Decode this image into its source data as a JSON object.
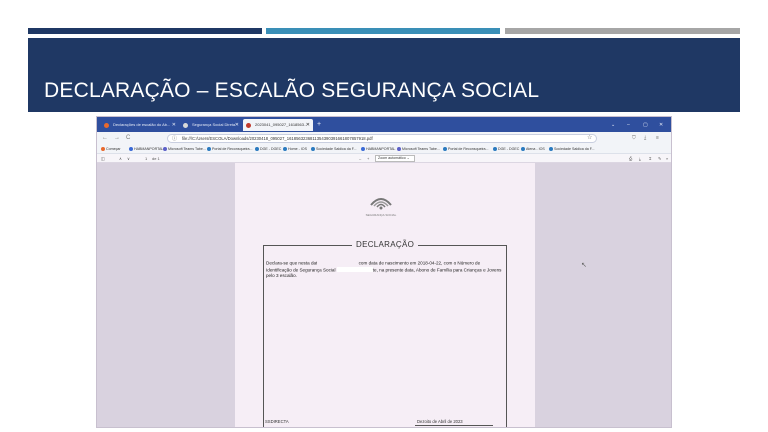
{
  "slide": {
    "title": "DECLARAÇÃO – ESCALÃO SEGURANÇA SOCIAL",
    "colors": {
      "dark_blue": "#1f3864",
      "mid_blue": "#3a8fb7",
      "gray": "#a6a6a6"
    }
  },
  "browser": {
    "tabs": [
      {
        "label": "Declarações de escalão do Ab...",
        "active": false,
        "icon": "firefox-icon"
      },
      {
        "label": "Segurança Social Direta",
        "active": false,
        "icon": "ss-icon"
      },
      {
        "label": "2023041_095027_1618563...",
        "active": true,
        "icon": "pdf-icon"
      }
    ],
    "new_tab": "+",
    "window_controls": [
      "⌄",
      "–",
      "▢",
      "✕"
    ],
    "nav": {
      "back": "←",
      "forward": "→",
      "reload": "C"
    },
    "url": "file:///C:/Users/ESCOLA/Downloads/20230418_095027_1618563236811354390391661807857918.pdf",
    "url_icon": "lock-icon",
    "bookmarks": [
      "Começar",
      "HABMANPORTAL",
      "Microsoft Teams Tabe...",
      "Portal de Reconsqueira...",
      "DGE - DGEC",
      "Home - IOS",
      "Sociedade Saldica da F...",
      "HABMANPORTAL",
      "Microsoft Teams Tabe...",
      "Portal de Reconsqueira...",
      "DGE - DGEC",
      "Atena - IOS",
      "Sociedade Saldica da F..."
    ]
  },
  "pdf_toolbar": {
    "page_current": "1",
    "page_total": "de 1",
    "zoom_minus": "–",
    "zoom_plus": "+",
    "zoom_label": "Zoom automático"
  },
  "document": {
    "logo_caption": "SEGURANÇA SOCIAL",
    "heading": "DECLARAÇÃO",
    "text_part1": "Declara-se que nesta dat",
    "text_part2": "com data de nascimento em 2018-04-22, com o Número de Identificação de Segurança Social",
    "text_part3": "te, na presente data, Abono de Família para Crianças e Jovens pelo 3 escalão.",
    "footer_left": "SSDIRECTA",
    "footer_right": "Dezoito de Abril de 2023"
  }
}
